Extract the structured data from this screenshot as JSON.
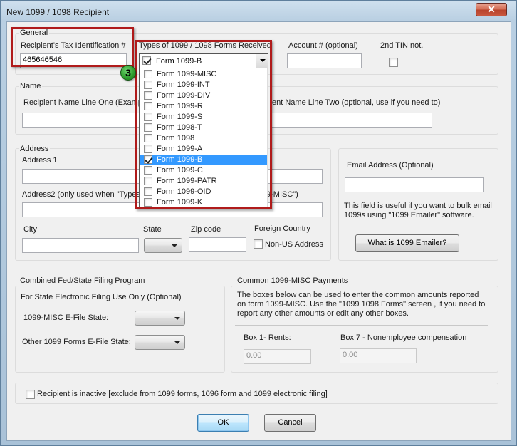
{
  "window": {
    "title": "New 1099 / 1098 Recipient",
    "close_glyph": "✕"
  },
  "general": {
    "group_title": "General",
    "tin_label": "Recipient's Tax Identification #",
    "tin_value": "465646546",
    "forms_label": "Types of 1099 / 1098 Forms Received",
    "forms_selected": "Form 1099-B",
    "account_label": "Account # (optional)",
    "account_value": "",
    "second_tin_label": "2nd TIN not."
  },
  "forms_dropdown": {
    "items": [
      {
        "label": "Form 1099-MISC",
        "checked": false
      },
      {
        "label": "Form 1099-INT",
        "checked": false
      },
      {
        "label": "Form 1099-DIV",
        "checked": false
      },
      {
        "label": "Form 1099-R",
        "checked": false
      },
      {
        "label": "Form 1099-S",
        "checked": false
      },
      {
        "label": "Form 1098-T",
        "checked": false
      },
      {
        "label": "Form 1098",
        "checked": false
      },
      {
        "label": "Form 1099-A",
        "checked": false
      },
      {
        "label": "Form 1099-B",
        "checked": true,
        "selected": true
      },
      {
        "label": "Form 1099-C",
        "checked": false
      },
      {
        "label": "Form 1099-PATR",
        "checked": false
      },
      {
        "label": "Form 1099-OID",
        "checked": false
      },
      {
        "label": "Form 1099-K",
        "checked": false
      }
    ]
  },
  "step_badge": "3",
  "name": {
    "group_title": "Name",
    "line1_label": "Recipient Name Line One (Examp",
    "line2_label": "ent Name Line Two (optional, use if you need to)"
  },
  "address": {
    "group_title": "Address",
    "address1_label": "Address 1",
    "address2_label": "Address2 (only used when \"Types",
    "address2_label_tail": "9-MISC\")",
    "city_label": "City",
    "state_label": "State",
    "zip_label": "Zip code",
    "foreign_label": "Foreign Country",
    "non_us_label": "Non-US Address"
  },
  "email": {
    "label": "Email Address (Optional)",
    "help": "This field is useful if you want to bulk email 1099s using \"1099 Emailer\" software.",
    "button": "What is 1099 Emailer?"
  },
  "fed_state": {
    "group_title": "Combined Fed/State Filing Program",
    "subtitle": "For State Electronic Filing Use Only (Optional)",
    "misc_label": "1099-MISC E-File State:",
    "other_label": "Other 1099 Forms E-File State:"
  },
  "misc_payments": {
    "group_title": "Common 1099-MISC Payments",
    "description": "The boxes below can be used to enter the common amounts reported on form 1099-MISC. Use the \"1099  1098 Forms\" screen , if you need to report any other amounts or edit any other boxes.",
    "box1_label": "Box 1- Rents:",
    "box1_value": "0.00",
    "box7_label": "Box 7 - Nonemployee compensation",
    "box7_value": "0.00"
  },
  "inactive": {
    "label": "Recipient is inactive [exclude from 1099 forms, 1096 form and 1099 electronic filing]",
    "checked": false
  },
  "buttons": {
    "ok": "OK",
    "cancel": "Cancel"
  }
}
